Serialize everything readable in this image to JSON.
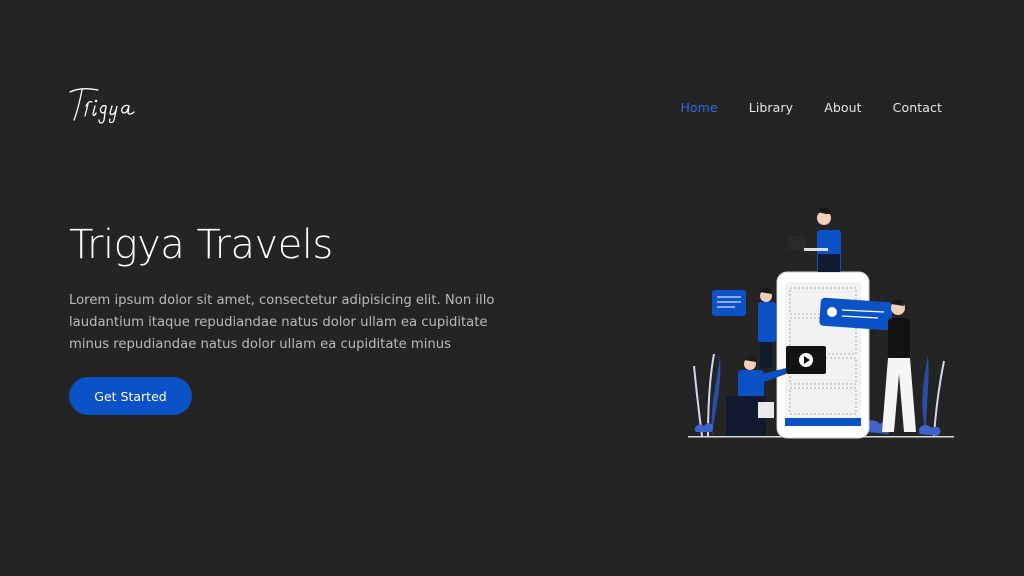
{
  "logo": {
    "text": "Trigya"
  },
  "nav": {
    "items": [
      {
        "label": "Home",
        "active": true
      },
      {
        "label": "Library",
        "active": false
      },
      {
        "label": "About",
        "active": false
      },
      {
        "label": "Contact",
        "active": false
      }
    ]
  },
  "hero": {
    "title": "Trigya Travels",
    "description": "Lorem ipsum dolor sit amet, consectetur adipisicing elit. Non illo laudantium itaque repudiandae natus dolor ullam ea cupiditate minus repudiandae natus dolor ullam ea cupiditate minus",
    "cta_label": "Get Started"
  },
  "illustration": {
    "subject": "team-building-mobile-app-illustration",
    "icon": "phone-ui-icon"
  },
  "colors": {
    "background": "#242424",
    "accent": "#0c52c7",
    "active_nav": "#2d6be4",
    "text_primary": "#ffffff",
    "text_muted": "#b9b9b9"
  }
}
